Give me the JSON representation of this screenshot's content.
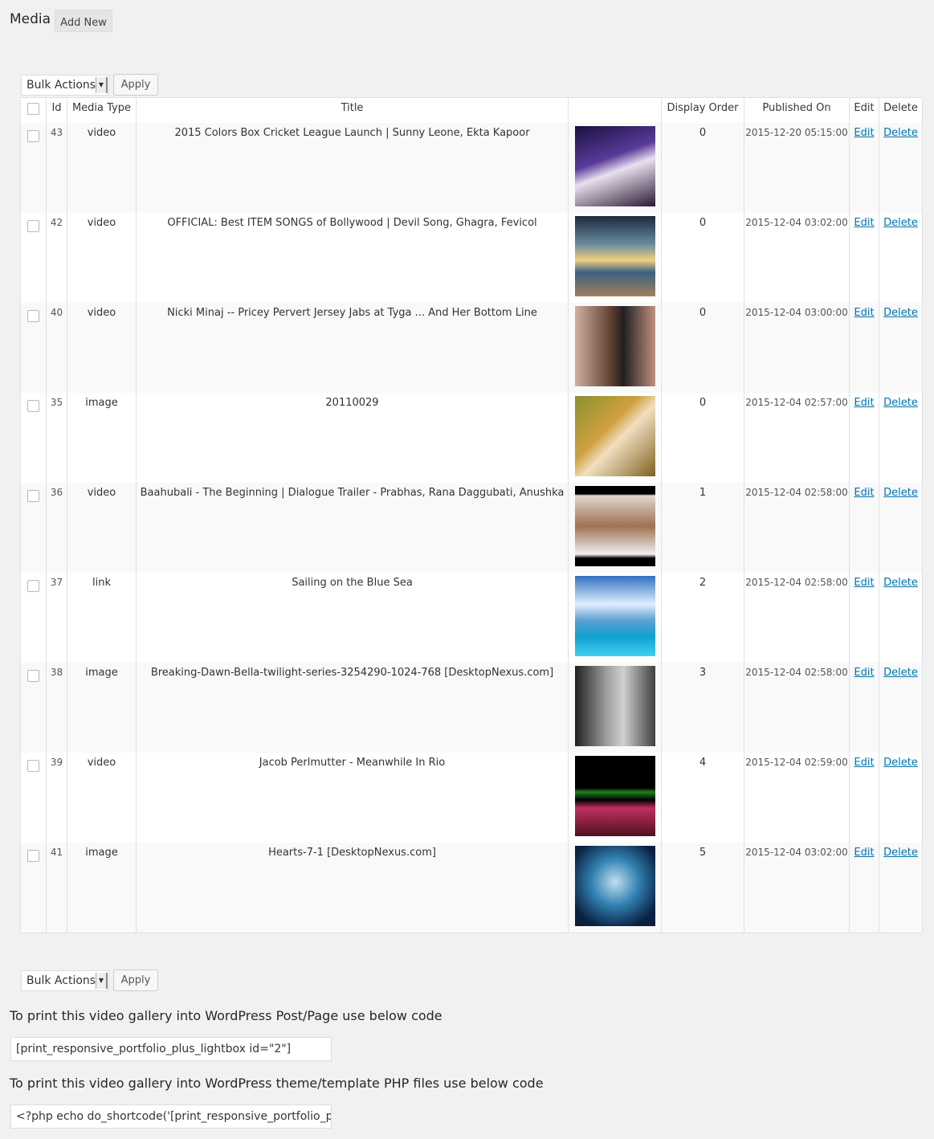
{
  "header": {
    "title": "Media",
    "add_new": "Add New"
  },
  "bulk": {
    "label": "Bulk Actions",
    "apply": "Apply"
  },
  "table": {
    "columns": [
      "Id",
      "Media Type",
      "Title",
      "",
      "Display Order",
      "Published On",
      "Edit",
      "Delete"
    ],
    "rows": [
      {
        "id": "43",
        "type": "video",
        "title": "2015 Colors Box Cricket League Launch | Sunny Leone, Ekta Kapoor",
        "order": "0",
        "date": "2015-12-20 05:15:00",
        "edit": "Edit",
        "delete": "Delete",
        "thumb": "linear-gradient(160deg,#1a1040,#5a3a9a 40%,#e8e0f0 55%,#2a1830)"
      },
      {
        "id": "42",
        "type": "video",
        "title": "OFFICIAL: Best ITEM SONGS of Bollywood | Devil Song, Ghagra, Fevicol",
        "order": "0",
        "date": "2015-12-04 03:02:00",
        "edit": "Edit",
        "delete": "Delete",
        "thumb": "linear-gradient(180deg,#1a2a3a,#6a8aa0 35%,#f0d080 55%,#3a6080 70%,#a08060)"
      },
      {
        "id": "40",
        "type": "video",
        "title": "Nicki Minaj -- Pricey Pervert Jersey Jabs at Tyga ... And Her Bottom Line",
        "order": "0",
        "date": "2015-12-04 03:00:00",
        "edit": "Edit",
        "delete": "Delete",
        "thumb": "linear-gradient(90deg,#d0b0a0,#604030 45%,#202020 60%,#c09080)"
      },
      {
        "id": "35",
        "type": "image",
        "title": "20110029",
        "order": "0",
        "date": "2015-12-04 02:57:00",
        "edit": "Edit",
        "delete": "Delete",
        "thumb": "linear-gradient(135deg,#8a9030,#d0a040 40%,#f0e0c0 55%,#806020)"
      },
      {
        "id": "36",
        "type": "video",
        "title": "Baahubali - The Beginning | Dialogue Trailer - Prabhas, Rana Daggubati, Anushka",
        "order": "1",
        "date": "2015-12-04 02:58:00",
        "edit": "Edit",
        "delete": "Delete",
        "thumb": "linear-gradient(180deg,#000 10%,#e0d8d0 12%,#a07050 50%,#f0f0f0 85%,#000 90%)"
      },
      {
        "id": "37",
        "type": "link",
        "title": "Sailing on the Blue Sea",
        "order": "2",
        "date": "2015-12-04 02:58:00",
        "edit": "Edit",
        "delete": "Delete",
        "thumb": "linear-gradient(180deg,#3070c0,#e0f0ff 35%,#60a0d0 55%,#10a0d0 75%,#40d0f0)"
      },
      {
        "id": "38",
        "type": "image",
        "title": "Breaking-Dawn-Bella-twilight-series-3254290-1024-768 [DesktopNexus.com]",
        "order": "3",
        "date": "2015-12-04 02:58:00",
        "edit": "Edit",
        "delete": "Delete",
        "thumb": "linear-gradient(90deg,#202020,#a0a0a0 40%,#d0d0d0 60%,#404040)"
      },
      {
        "id": "39",
        "type": "video",
        "title": "Jacob Perlmutter - Meanwhile In Rio",
        "order": "4",
        "date": "2015-12-04 02:59:00",
        "edit": "Edit",
        "delete": "Delete",
        "thumb": "linear-gradient(180deg,#000 40%,#208020 45%,#000 55%,#c03060 65%,#501020)"
      },
      {
        "id": "41",
        "type": "image",
        "title": "Hearts-7-1 [DesktopNexus.com]",
        "order": "5",
        "date": "2015-12-04 03:02:00",
        "edit": "Edit",
        "delete": "Delete",
        "thumb": "radial-gradient(circle at 50% 45%,#c0e0f0,#3080b0 40%,#0a2040 80%)"
      }
    ]
  },
  "footer": {
    "label1": "To print this video gallery into WordPress Post/Page use below code",
    "code1": "[print_responsive_portfolio_plus_lightbox id=\"2\"]",
    "label2": "To print this video gallery into WordPress theme/template PHP files use below code",
    "code2": "<?php echo do_shortcode('[print_responsive_portfolio_plu:"
  }
}
